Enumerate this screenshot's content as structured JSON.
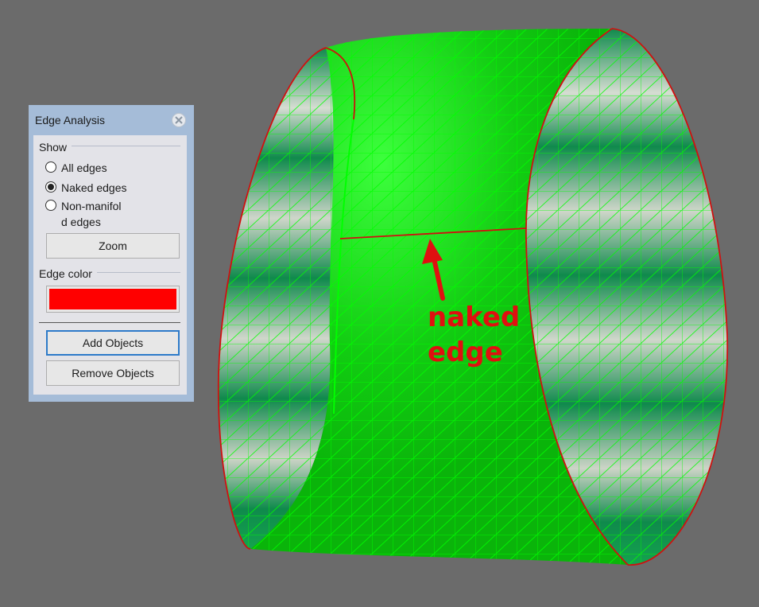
{
  "panel": {
    "title": "Edge Analysis",
    "show_label": "Show",
    "options": [
      {
        "label": "All edges",
        "selected": false
      },
      {
        "label": "Naked edges",
        "selected": true
      },
      {
        "label": "Non-manifol",
        "label2": "d edges",
        "selected": false
      }
    ],
    "zoom_label": "Zoom",
    "edge_color_label": "Edge color",
    "edge_color": "#ff0000",
    "add_objects_label": "Add Objects",
    "remove_objects_label": "Remove Objects"
  },
  "viewport": {
    "annotation_line1": "naked",
    "annotation_line2": "edge",
    "annotation_color": "#e01010",
    "mesh_color": "#00ff00",
    "surface_color": "#0cbf0c",
    "background": "#6b6b6b"
  }
}
